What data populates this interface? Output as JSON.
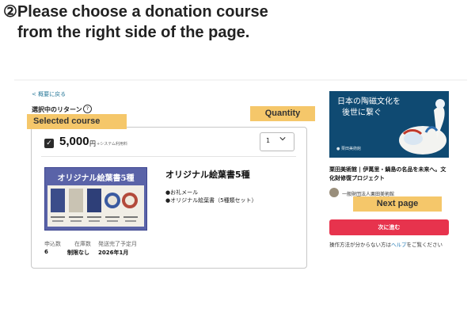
{
  "instructions": {
    "line1": "②Please choose a donation course",
    "line2": "from the right side of the page."
  },
  "callouts": {
    "selected_course": "Selected course",
    "quantity": "Quantity",
    "next_page": "Next page"
  },
  "page": {
    "back_link": "< 概要に戻る",
    "section_title": "選択中のリターン",
    "help_glyph": "?"
  },
  "course": {
    "price": "5,000",
    "price_unit": "円",
    "price_note": "+システム利用料",
    "quantity": "1",
    "thumbnail_title": "オリジナル絵葉書5種",
    "title": "オリジナル絵葉書5種",
    "items": [
      "●お礼メール",
      "●オリジナル絵葉書（5種類セット）"
    ],
    "meta": {
      "applications_label": "申込数",
      "applications_value": "6",
      "stock_label": "在庫数",
      "stock_value": "制限なし",
      "delivery_label": "発送完了予定月",
      "delivery_value": "2026年1月"
    }
  },
  "project": {
    "hero_line1": "日本の陶磁文化を",
    "hero_line2": "後世に繋ぐ",
    "hero_credit": "● 栗田美術館",
    "title": "栗田美術館 | 伊萬里・鍋島の名品を未来へ。文化財修復プロジェクト",
    "organization": "一般財団法人栗田美術館"
  },
  "actions": {
    "next_label": "次に進む",
    "help_prefix": "操作方法が分からない方は",
    "help_link": "ヘルプ",
    "help_suffix": "をご覧ください"
  },
  "colors": {
    "callout": "#f5c76a",
    "next_button": "#e7334d",
    "link": "#2a7a9a",
    "thumbnail": "#5a63a8",
    "hero": "#0f4a72"
  },
  "icons": [
    "help-icon",
    "checkbox-icon",
    "chevron-down-icon",
    "avatar"
  ]
}
